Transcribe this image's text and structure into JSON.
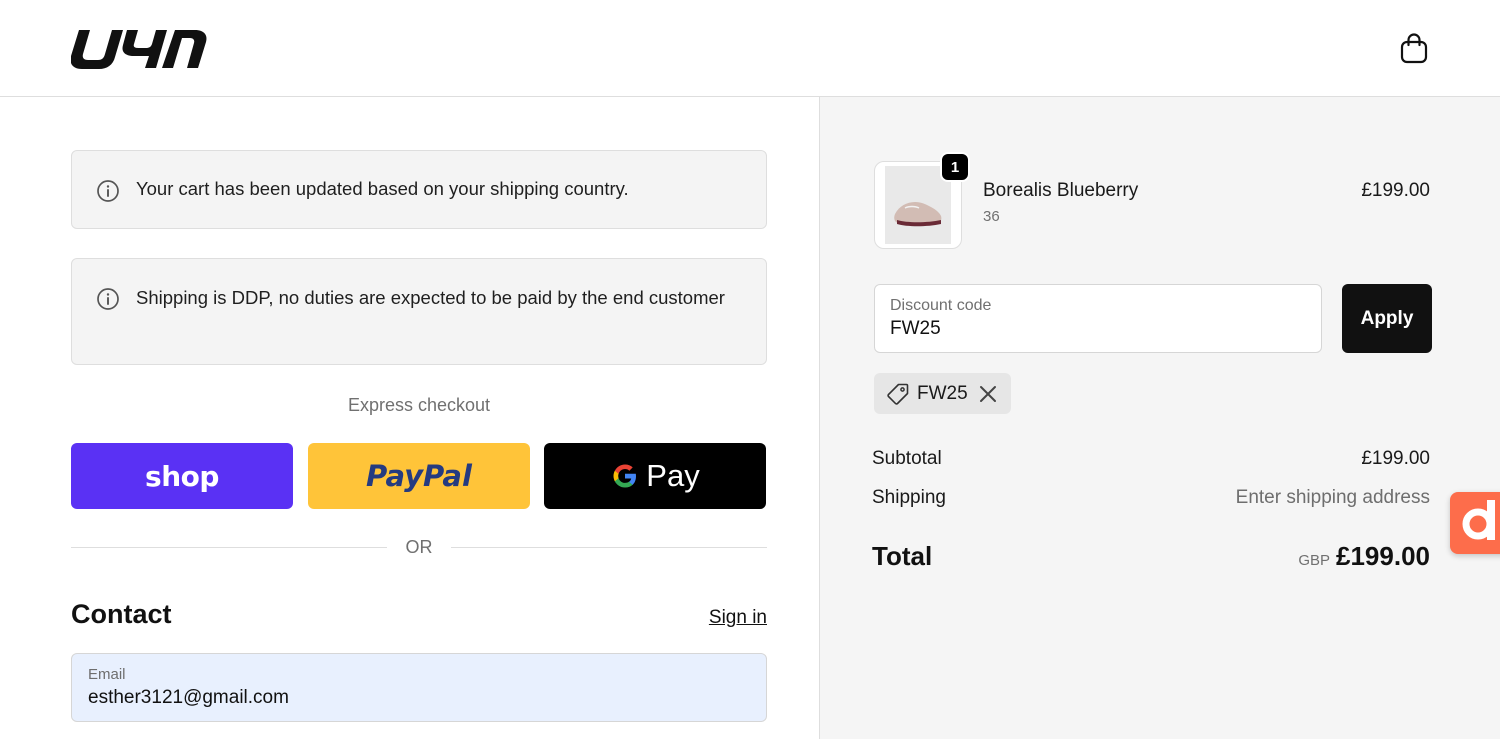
{
  "header": {
    "logo_text": "uyn",
    "bag_icon": "shopping-bag-icon"
  },
  "banners": [
    {
      "icon": "info-icon",
      "text": "Your cart has been updated based on your shipping country."
    },
    {
      "icon": "info-icon",
      "text": "Shipping is DDP, no duties are expected to be paid by the end customer"
    }
  ],
  "express": {
    "label": "Express checkout",
    "buttons": [
      {
        "label": "shop",
        "color": "#5a31f4"
      },
      {
        "label": "PayPal",
        "color": "#ffc439"
      },
      {
        "label": "Pay",
        "icon": "google-g-icon",
        "color": "#000000"
      }
    ],
    "or_text": "OR"
  },
  "contact": {
    "title": "Contact",
    "sign_in": "Sign in",
    "email_label": "Email",
    "email_value": "esther3121@gmail.com"
  },
  "order": {
    "item": {
      "quantity": "1",
      "name": "Borealis Blueberry",
      "variant": "36",
      "price": "£199.00",
      "image_icon": "shoe-thumbnail"
    },
    "discount": {
      "placeholder": "Discount code",
      "value": "FW25",
      "apply_label": "Apply",
      "applied_code": "FW25"
    },
    "summary": {
      "subtotal_label": "Subtotal",
      "subtotal_value": "£199.00",
      "shipping_label": "Shipping",
      "shipping_value": "Enter shipping address",
      "total_label": "Total",
      "currency": "GBP",
      "total_value": "£199.00"
    }
  },
  "floating_widget": {
    "icon": "d-logo-icon",
    "color": "#fd6d4b"
  }
}
